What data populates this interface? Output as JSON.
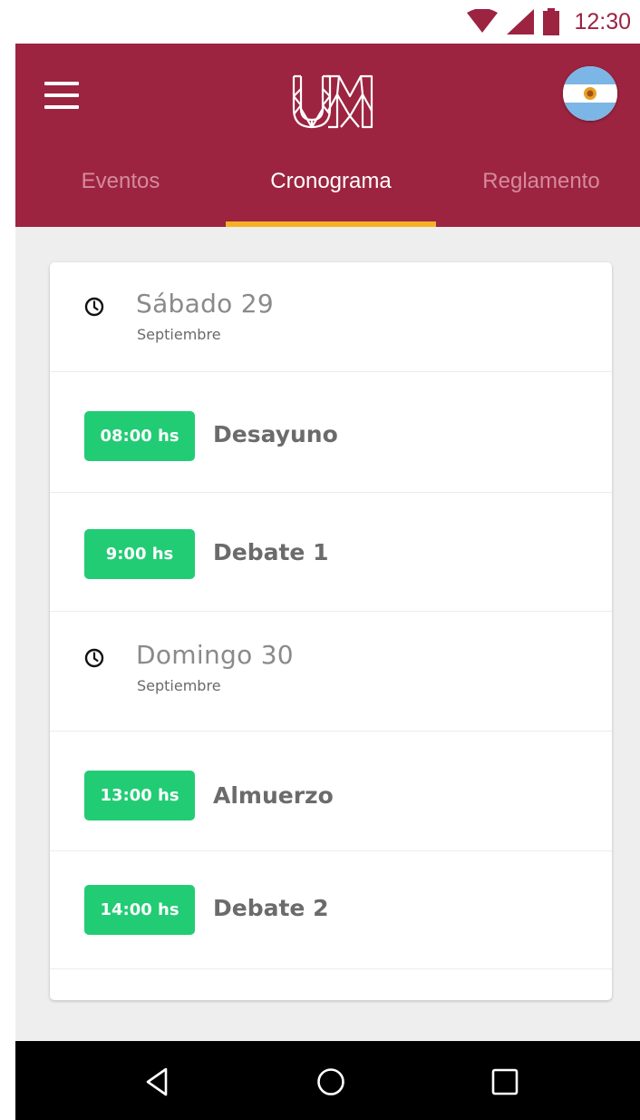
{
  "status_bar": {
    "time": "12:30",
    "icons": [
      "wifi-icon",
      "cell-signal-icon",
      "battery-icon"
    ]
  },
  "app_bar": {
    "logo_icon": "um-logo",
    "menu_icon": "hamburger-menu-icon",
    "flag_icon": "argentina-flag-icon",
    "tabs": [
      {
        "label": "Eventos",
        "active": false
      },
      {
        "label": "Cronograma",
        "active": true
      },
      {
        "label": "Reglamento",
        "active": false
      }
    ]
  },
  "schedule": {
    "days": [
      {
        "title": "Sábado 29",
        "subtitle": "Septiembre",
        "events": [
          {
            "time": "08:00 hs",
            "title": "Desayuno"
          },
          {
            "time": "9:00 hs",
            "title": "Debate 1"
          }
        ]
      },
      {
        "title": "Domingo 30",
        "subtitle": "Septiembre",
        "events": [
          {
            "time": "13:00 hs",
            "title": "Almuerzo"
          },
          {
            "time": "14:00 hs",
            "title": "Debate 2"
          }
        ]
      }
    ]
  },
  "nav_bar": {
    "buttons": [
      "back-icon",
      "home-icon",
      "recents-icon"
    ]
  },
  "colors": {
    "primary": "#9c2440",
    "accent": "#f6b026",
    "badge": "#22cc74",
    "background": "#eeeeee"
  }
}
